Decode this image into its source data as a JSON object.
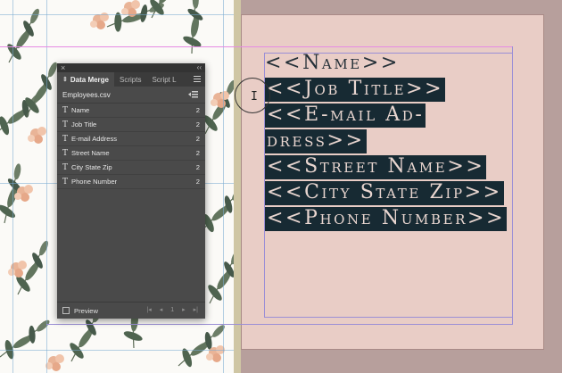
{
  "panel": {
    "tabs": [
      {
        "label": "Data Merge"
      },
      {
        "label": "Scripts"
      },
      {
        "label": "Script L"
      }
    ],
    "source_file": "Employees.csv",
    "fields": [
      {
        "label": "Name",
        "count": "2"
      },
      {
        "label": "Job Title",
        "count": "2"
      },
      {
        "label": "E-mail Address",
        "count": "2"
      },
      {
        "label": "Street Name",
        "count": "2"
      },
      {
        "label": "City State Zip",
        "count": "2"
      },
      {
        "label": "Phone Number",
        "count": "2"
      }
    ],
    "preview_label": "Preview",
    "page_number": "1"
  },
  "document": {
    "lines": [
      {
        "text": "<<Name>>",
        "highlighted": false
      },
      {
        "text": "<<Job Title>>",
        "highlighted": true
      },
      {
        "text": "<<E-mail Ad-",
        "highlighted": true
      },
      {
        "text": "dress>>",
        "highlighted": true
      },
      {
        "text": "<<Street Name>>",
        "highlighted": true
      },
      {
        "text": "<<City State Zip>>",
        "highlighted": true
      },
      {
        "text": "<<Phone Number>>",
        "highlighted": true
      }
    ]
  },
  "colors": {
    "page_pink": "#e9cdc6",
    "pasteboard": "#b79f9c",
    "selection_dark": "#172a33",
    "panel_bg": "#4a4a4a"
  }
}
